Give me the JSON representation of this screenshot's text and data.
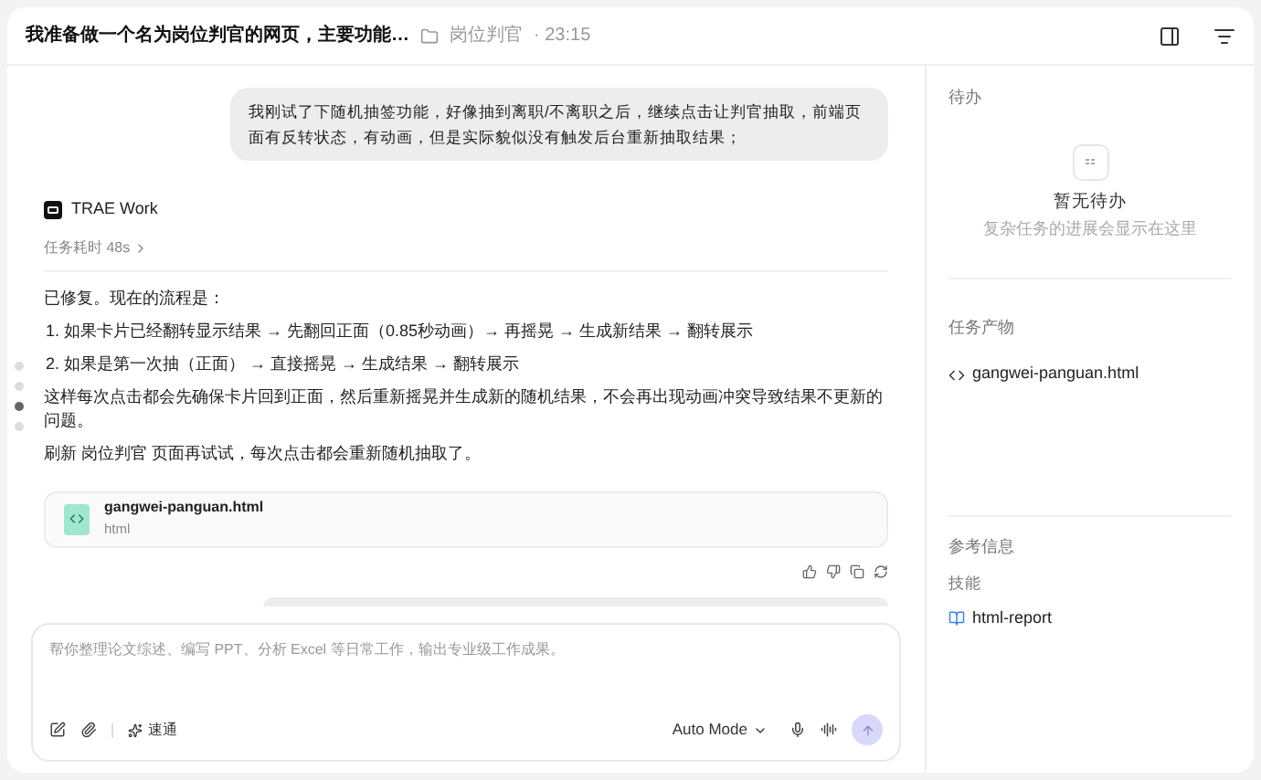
{
  "header": {
    "title": "我准备做一个名为岗位判官的网页，主要功能…",
    "folder": "岗位判官",
    "time": "· 23:15"
  },
  "user_message": "我刚试了下随机抽签功能，好像抽到离职/不离职之后，继续点击让判官抽取，前端页面有反转状态，有动画，但是实际貌似没有触发后台重新抽取结果；",
  "assistant": {
    "name": "TRAE Work",
    "duration": "任务耗时 48s",
    "paragraphs": [
      {
        "kind": "text",
        "text": "已修复。现在的流程是："
      },
      {
        "kind": "list",
        "text": "1. 如果卡片已经翻转显示结果 → 先翻回正面（0.85秒动画）→ 再摇晃 → 生成新结果 → 翻转展示"
      },
      {
        "kind": "list",
        "text": "2. 如果是第一次抽（正面） → 直接摇晃 → 生成结果 → 翻转展示"
      },
      {
        "kind": "text",
        "text": "这样每次点击都会先确保卡片回到正面，然后重新摇晃并生成新的随机结果，不会再出现动画冲突导致结果不更新的问题。"
      },
      {
        "kind": "text",
        "text": "刷新 岗位判官 页面再试试，每次点击都会重新随机抽取了。"
      }
    ],
    "file": {
      "name": "gangwei-panguan.html",
      "type": "html"
    }
  },
  "scroll_dots": [
    {
      "selected": false
    },
    {
      "selected": false
    },
    {
      "selected": true
    },
    {
      "selected": false
    }
  ],
  "composer": {
    "placeholder": "帮你整理论文综述、编写 PPT、分析 Excel 等日常工作，输出专业级工作成果。",
    "skill_button": "速通",
    "mode": "Auto Mode"
  },
  "sidebar": {
    "todo": {
      "title": "待办",
      "empty_title": "暂无待办",
      "empty_subtitle": "复杂任务的进展会显示在这里"
    },
    "outputs": {
      "title": "任务产物",
      "items": [
        "gangwei-panguan.html"
      ]
    },
    "references": {
      "title": "参考信息",
      "skills_label": "技能",
      "skills": [
        "html-report"
      ]
    }
  }
}
